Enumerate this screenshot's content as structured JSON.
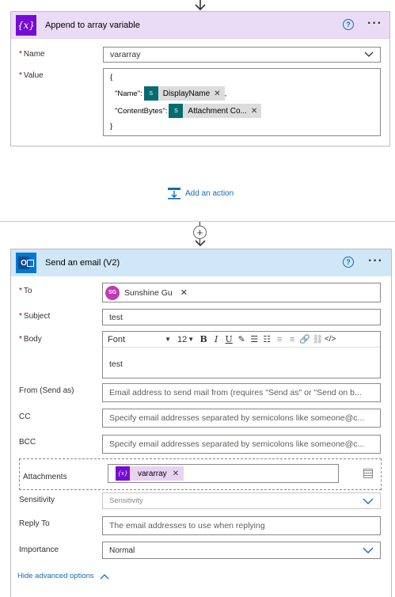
{
  "append_card": {
    "title": "Append to array variable",
    "icon_glyph": "{x}",
    "name_label": "Name",
    "name_value": "vararray",
    "value_label": "Value",
    "value_lines": {
      "open": "{",
      "name_key": "\"Name\":",
      "name_token": "DisplayName",
      "name_suffix": ",",
      "bytes_key": "\"ContentBytes\":",
      "bytes_token": "Attachment Co...",
      "close": "}"
    },
    "sp_glyph": "S"
  },
  "add_action": {
    "label": "Add an action"
  },
  "email_card": {
    "title": "Send an email (V2)",
    "to_label": "To",
    "to_person_initials": "SG",
    "to_person_name": "Sunshine Gu",
    "subject_label": "Subject",
    "subject_value": "test",
    "body_label": "Body",
    "toolbar": {
      "font": "Font",
      "size": "12"
    },
    "body_value": "test",
    "from_label": "From (Send as)",
    "from_placeholder": "Email address to send mail from (requires \"Send as\" or \"Send on b...",
    "cc_label": "CC",
    "cc_placeholder": "Specify email addresses separated by semicolons like someone@c...",
    "bcc_label": "BCC",
    "bcc_placeholder": "Specify email addresses separated by semicolons like someone@c...",
    "attachments_label": "Attachments",
    "attachments_token": "vararray",
    "sensitivity_label": "Sensitivity",
    "sensitivity_placeholder": "Sensitivity",
    "replyto_label": "Reply To",
    "replyto_placeholder": "The email addresses to use when replying",
    "importance_label": "Importance",
    "importance_value": "Normal",
    "hide_advanced": "Hide advanced options"
  },
  "colors": {
    "append_header": "#eadcf6",
    "append_icon": "#770bd6",
    "email_header": "#d0e7f8",
    "outlook_blue": "#0078d4",
    "accent": "#0f6cbd"
  }
}
